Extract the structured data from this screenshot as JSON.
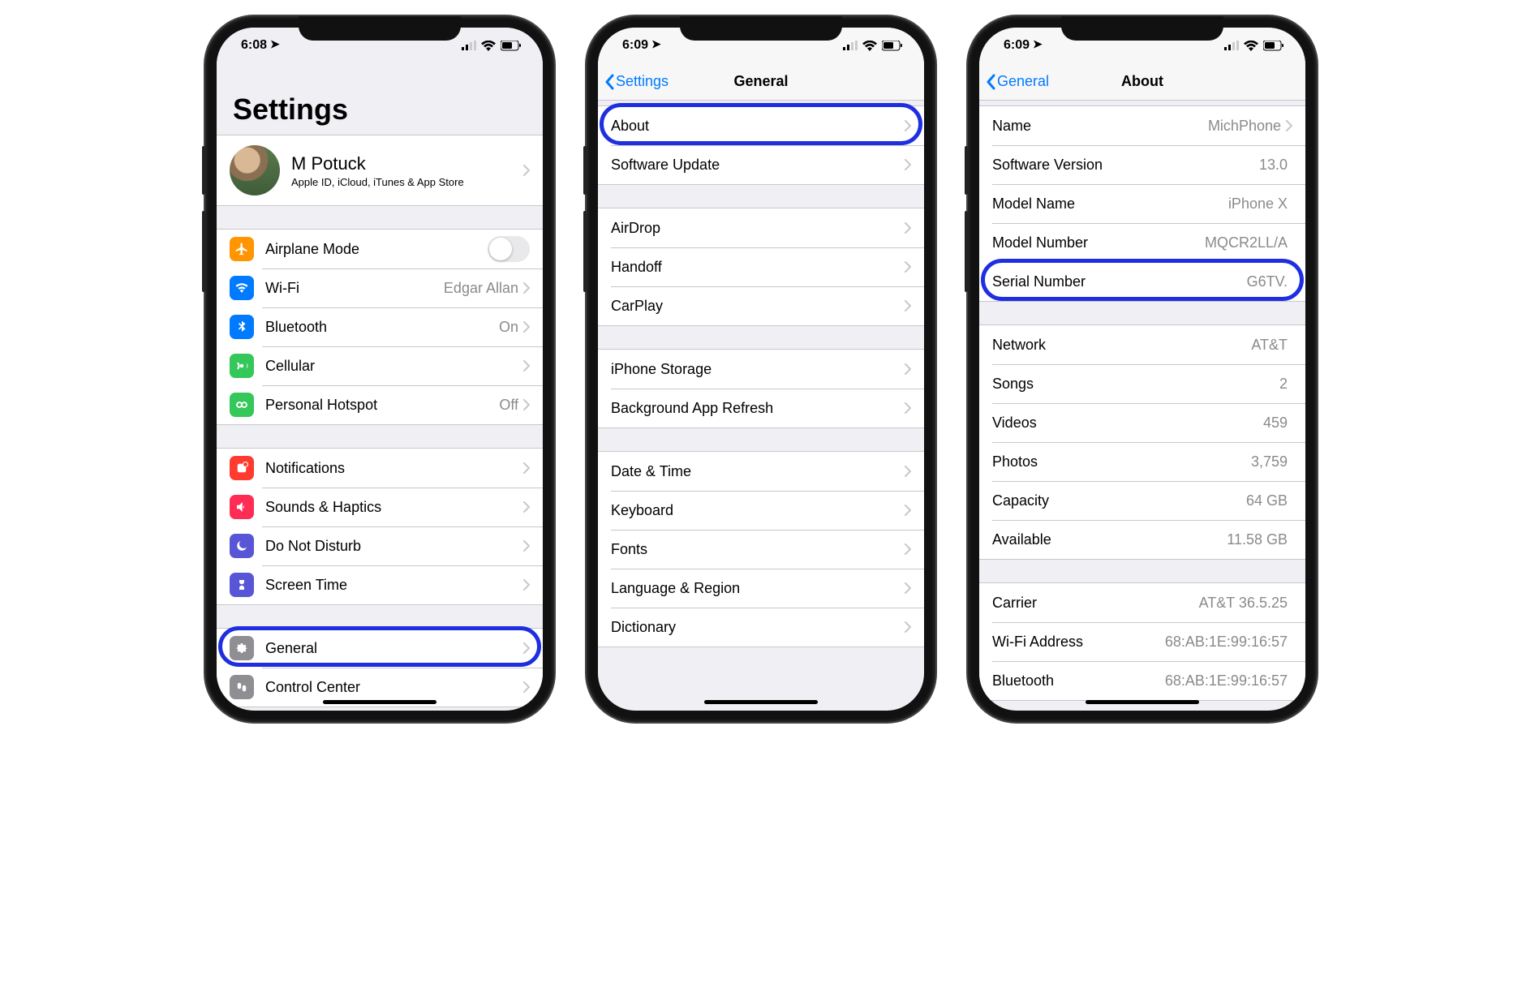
{
  "phones": {
    "settings": {
      "time": "6:08",
      "title": "Settings",
      "profile": {
        "name": "M Potuck",
        "subtitle": "Apple ID, iCloud, iTunes & App Store"
      },
      "group_connectivity": [
        {
          "label": "Airplane Mode",
          "icon": "airplane",
          "color": "#ff9500",
          "toggle": true
        },
        {
          "label": "Wi-Fi",
          "icon": "wifi",
          "color": "#007aff",
          "value": "Edgar Allan"
        },
        {
          "label": "Bluetooth",
          "icon": "bluetooth",
          "color": "#007aff",
          "value": "On"
        },
        {
          "label": "Cellular",
          "icon": "cellular",
          "color": "#34c759"
        },
        {
          "label": "Personal Hotspot",
          "icon": "hotspot",
          "color": "#34c759",
          "value": "Off"
        }
      ],
      "group_notifications": [
        {
          "label": "Notifications",
          "icon": "notifications",
          "color": "#ff3b30"
        },
        {
          "label": "Sounds & Haptics",
          "icon": "sounds",
          "color": "#ff2d55"
        },
        {
          "label": "Do Not Disturb",
          "icon": "dnd",
          "color": "#5856d6"
        },
        {
          "label": "Screen Time",
          "icon": "screentime",
          "color": "#5856d6"
        }
      ],
      "group_system": [
        {
          "label": "General",
          "icon": "general",
          "color": "#8e8e93",
          "highlight": true
        },
        {
          "label": "Control Center",
          "icon": "controlcenter",
          "color": "#8e8e93"
        }
      ]
    },
    "general": {
      "time": "6:09",
      "back": "Settings",
      "title": "General",
      "group1": [
        {
          "label": "About",
          "highlight": true
        },
        {
          "label": "Software Update"
        }
      ],
      "group2": [
        {
          "label": "AirDrop"
        },
        {
          "label": "Handoff"
        },
        {
          "label": "CarPlay"
        }
      ],
      "group3": [
        {
          "label": "iPhone Storage"
        },
        {
          "label": "Background App Refresh"
        }
      ],
      "group4": [
        {
          "label": "Date & Time"
        },
        {
          "label": "Keyboard"
        },
        {
          "label": "Fonts"
        },
        {
          "label": "Language & Region"
        },
        {
          "label": "Dictionary"
        }
      ]
    },
    "about": {
      "time": "6:09",
      "back": "General",
      "title": "About",
      "group1": [
        {
          "label": "Name",
          "value": "MichPhone",
          "chevron": true
        },
        {
          "label": "Software Version",
          "value": "13.0"
        },
        {
          "label": "Model Name",
          "value": "iPhone X"
        },
        {
          "label": "Model Number",
          "value": "MQCR2LL/A"
        },
        {
          "label": "Serial Number",
          "value": "G6TV.",
          "highlight": true
        }
      ],
      "group2": [
        {
          "label": "Network",
          "value": "AT&T"
        },
        {
          "label": "Songs",
          "value": "2"
        },
        {
          "label": "Videos",
          "value": "459"
        },
        {
          "label": "Photos",
          "value": "3,759"
        },
        {
          "label": "Capacity",
          "value": "64 GB"
        },
        {
          "label": "Available",
          "value": "11.58 GB"
        }
      ],
      "group3": [
        {
          "label": "Carrier",
          "value": "AT&T 36.5.25"
        },
        {
          "label": "Wi-Fi Address",
          "value": "68:AB:1E:99:16:57"
        },
        {
          "label": "Bluetooth",
          "value": "68:AB:1E:99:16:57"
        }
      ]
    }
  }
}
